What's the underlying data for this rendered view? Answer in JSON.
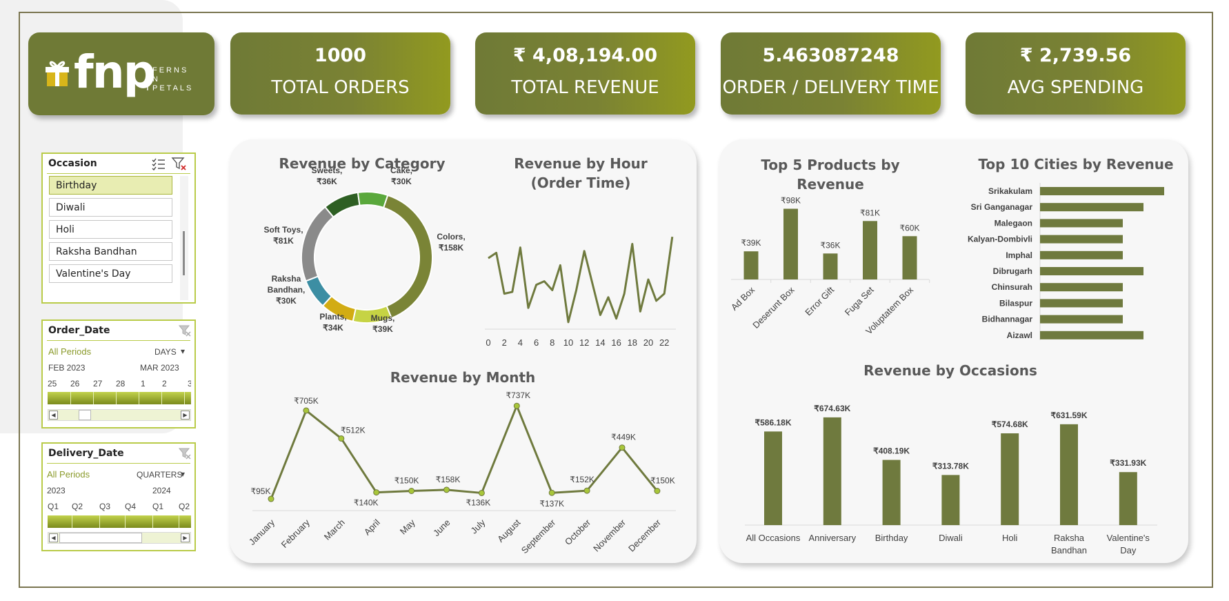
{
  "brand": {
    "logo_text": "fnp",
    "logo_sub": [
      "FERNS",
      "N",
      "PETALS"
    ]
  },
  "kpis": [
    {
      "value": "1000",
      "label": "TOTAL ORDERS"
    },
    {
      "value": "₹ 4,08,194.00",
      "label": "TOTAL REVENUE"
    },
    {
      "value": "5.463087248",
      "label": "ORDER / DELIVERY TIME"
    },
    {
      "value": "₹ 2,739.56",
      "label": "AVG SPENDING"
    }
  ],
  "slicers": {
    "occasion": {
      "title": "Occasion",
      "items": [
        "Birthday",
        "Diwali",
        "Holi",
        "Raksha Bandhan",
        "Valentine's Day"
      ],
      "selected": "Birthday"
    },
    "order_date": {
      "title": "Order_Date",
      "period_label": "All Periods",
      "level": "DAYS",
      "groups": [
        "FEB 2023",
        "MAR 2023"
      ],
      "ticks": [
        "25",
        "26",
        "27",
        "28",
        "1",
        "2",
        "3"
      ]
    },
    "delivery_date": {
      "title": "Delivery_Date",
      "period_label": "All Periods",
      "level": "QUARTERS",
      "groups": [
        "2023",
        "2024"
      ],
      "ticks": [
        "Q1",
        "Q2",
        "Q3",
        "Q4",
        "Q1",
        "Q2"
      ]
    }
  },
  "colors": {
    "kpi_start": "#6f7a36",
    "kpi_end": "#929a1f",
    "bar": "#6f7a3e",
    "line": "#6f7a3e",
    "marker": "#a8c63a",
    "slicer_border": "#b9cb48"
  },
  "chart_data": [
    {
      "id": "category",
      "type": "pie",
      "title": "Revenue by Category",
      "slices": [
        {
          "name": "Colors",
          "value": 158,
          "label": "Colors,|₹158K",
          "color": "#7a8436"
        },
        {
          "name": "Mugs",
          "value": 39,
          "label": "Mugs,|₹39K",
          "color": "#c6d344"
        },
        {
          "name": "Plants",
          "value": 34,
          "label": "Plants,|₹34K",
          "color": "#d2ac14"
        },
        {
          "name": "Raksha Bandhan",
          "value": 30,
          "label": "Raksha|Bandhan,|₹30K",
          "color": "#3c8ea3"
        },
        {
          "name": "Soft Toys",
          "value": 81,
          "label": "Soft Toys,|₹81K",
          "color": "#8a8a8a"
        },
        {
          "name": "Sweets",
          "value": 36,
          "label": "Sweets,|₹36K",
          "color": "#2e5f23"
        },
        {
          "name": "Cake",
          "value": 30,
          "label": "Cake,|₹30K",
          "color": "#5aa83c"
        }
      ]
    },
    {
      "id": "hour",
      "type": "line",
      "title": "Revenue by Hour (Order Time)",
      "x": [
        0,
        1,
        2,
        3,
        4,
        5,
        6,
        7,
        8,
        9,
        10,
        11,
        12,
        13,
        14,
        15,
        16,
        17,
        18,
        19,
        20,
        21,
        22,
        23
      ],
      "values": [
        16,
        17.5,
        6,
        6.5,
        19,
        2,
        8.5,
        9.5,
        7,
        14,
        -2,
        7,
        18,
        9,
        0,
        5,
        -1,
        6,
        20,
        1,
        10,
        4,
        6,
        22
      ],
      "ylim": [
        -3,
        30
      ],
      "xticks": [
        "0",
        "2",
        "4",
        "6",
        "8",
        "10",
        "12",
        "14",
        "16",
        "18",
        "20",
        "22"
      ]
    },
    {
      "id": "month",
      "type": "line",
      "title": "Revenue by Month",
      "categories": [
        "January",
        "February",
        "March",
        "April",
        "May",
        "June",
        "July",
        "August",
        "September",
        "October",
        "November",
        "December"
      ],
      "values": [
        95,
        705,
        512,
        140,
        150,
        158,
        136,
        737,
        137,
        152,
        449,
        150
      ],
      "labels": [
        "₹95K",
        "₹705K",
        "₹512K",
        "₹140K",
        "₹150K",
        "₹158K",
        "₹136K",
        "₹737K",
        "₹137K",
        "₹152K",
        "₹449K",
        "₹150K"
      ],
      "ylim": [
        0,
        800
      ]
    },
    {
      "id": "products",
      "type": "bar",
      "title": "Top 5 Products by Revenue",
      "categories": [
        "Ad Box",
        "Deserunt Box",
        "Error Gift",
        "Fuga Set",
        "Voluptatem Box"
      ],
      "values": [
        39,
        98,
        36,
        81,
        60
      ],
      "labels": [
        "₹39K",
        "₹98K",
        "₹36K",
        "₹81K",
        "₹60K"
      ],
      "ylim": [
        0,
        110
      ]
    },
    {
      "id": "cities",
      "type": "bar",
      "orientation": "horizontal",
      "title": "Top 10 Cities by Revenue",
      "categories": [
        "Srikakulam",
        "Sri Ganganagar",
        "Malegaon",
        "Kalyan-Dombivli",
        "Imphal",
        "Dibrugarh",
        "Chinsurah",
        "Bilaspur",
        "Bidhannagar",
        "Aizawl"
      ],
      "values": [
        6,
        5,
        4,
        4,
        4,
        5,
        4,
        4,
        4,
        5
      ]
    },
    {
      "id": "occasions",
      "type": "bar",
      "title": "Revenue by Occasions",
      "categories": [
        "All Occasions",
        "Anniversary",
        "Birthday",
        "Diwali",
        "Holi",
        "Raksha|Bandhan",
        "Valentine's|Day"
      ],
      "values": [
        586.18,
        674.63,
        408.19,
        313.78,
        574.68,
        631.59,
        331.93
      ],
      "labels": [
        "₹586.18K",
        "₹674.63K",
        "₹408.19K",
        "₹313.78K",
        "₹574.68K",
        "₹631.59K",
        "₹331.93K"
      ],
      "ylim": [
        0,
        700
      ]
    }
  ]
}
